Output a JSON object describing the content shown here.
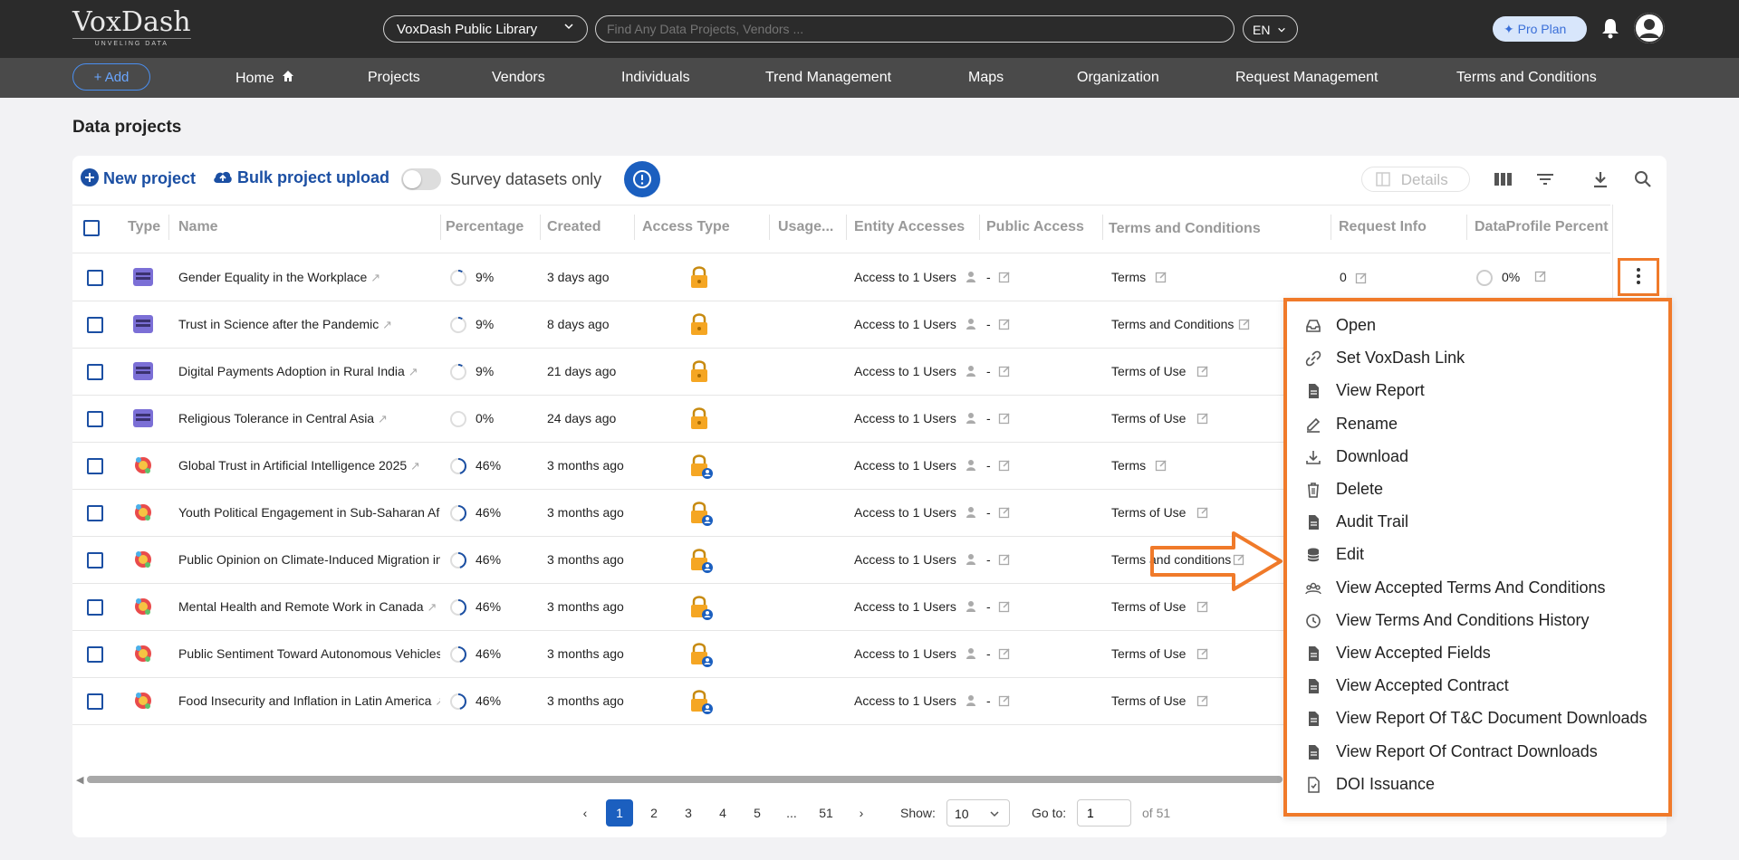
{
  "header": {
    "logo_main": "VoxDash",
    "logo_sub": "UNVELING DATA",
    "library_select": "VoxDash Public Library",
    "search_placeholder": "Find Any Data Projects, Vendors ...",
    "language": "EN",
    "plan_label": "✦ Pro Plan",
    "icons": [
      "chevron-down-icon",
      "bell-icon",
      "user-avatar-icon"
    ]
  },
  "nav": {
    "add_label": "+ Add",
    "items": [
      "Home",
      "Projects",
      "Vendors",
      "Individuals",
      "Trend Management",
      "Maps",
      "Organization",
      "Request Management",
      "Terms and Conditions"
    ]
  },
  "page": {
    "title": "Data projects",
    "new_project": "New project",
    "bulk_upload": "Bulk project upload",
    "survey_toggle": "Survey datasets only",
    "survey_toggle_on": false,
    "details": "Details"
  },
  "table": {
    "columns": [
      "Type",
      "Name",
      "Percentage",
      "Created",
      "Access Type",
      "Usage...",
      "Entity Accesses",
      "Public Access",
      "Terms and Conditions",
      "Request Info",
      "DataProfile Percent"
    ],
    "rows": [
      {
        "type": "dataset",
        "name": "Gender Equality in the Workplace",
        "pct": "9%",
        "pct_value": 0.09,
        "created": "3 days ago",
        "access": "lock",
        "entity": "Access to 1 Users",
        "public": "-",
        "terms": "Terms",
        "request": "0",
        "dp": "0%"
      },
      {
        "type": "dataset",
        "name": "Trust in Science after the Pandemic",
        "pct": "9%",
        "pct_value": 0.09,
        "created": "8 days ago",
        "access": "lock",
        "entity": "Access to 1 Users",
        "public": "-",
        "terms": "Terms and Conditions"
      },
      {
        "type": "dataset",
        "name": "Digital Payments Adoption in Rural India",
        "pct": "9%",
        "pct_value": 0.09,
        "created": "21 days ago",
        "access": "lock",
        "entity": "Access to 1 Users",
        "public": "-",
        "terms": "Terms of Use"
      },
      {
        "type": "dataset",
        "name": "Religious Tolerance in Central Asia",
        "pct": "0%",
        "pct_value": 0,
        "created": "24 days ago",
        "access": "lock",
        "entity": "Access to 1 Users",
        "public": "-",
        "terms": "Terms of Use"
      },
      {
        "type": "survey",
        "name": "Global Trust in Artificial Intelligence 2025",
        "pct": "46%",
        "pct_value": 0.46,
        "created": "3 months ago",
        "access": "lock-user",
        "entity": "Access to 1 Users",
        "public": "-",
        "terms": "Terms"
      },
      {
        "type": "survey",
        "name": "Youth Political Engagement in Sub-Saharan Afr",
        "pct": "46%",
        "pct_value": 0.46,
        "created": "3 months ago",
        "access": "lock-user",
        "entity": "Access to 1 Users",
        "public": "-",
        "terms": "Terms of Use"
      },
      {
        "type": "survey",
        "name": "Public Opinion on Climate-Induced Migration in",
        "pct": "46%",
        "pct_value": 0.46,
        "created": "3 months ago",
        "access": "lock-user",
        "entity": "Access to 1 Users",
        "public": "-",
        "terms": "Terms and conditions"
      },
      {
        "type": "survey",
        "name": "Mental Health and Remote Work in Canada",
        "pct": "46%",
        "pct_value": 0.46,
        "created": "3 months ago",
        "access": "lock-user",
        "entity": "Access to 1 Users",
        "public": "-",
        "terms": "Terms of Use"
      },
      {
        "type": "survey",
        "name": "Public Sentiment Toward Autonomous Vehicles",
        "pct": "46%",
        "pct_value": 0.46,
        "created": "3 months ago",
        "access": "lock-user",
        "entity": "Access to 1 Users",
        "public": "-",
        "terms": "Terms of Use"
      },
      {
        "type": "survey",
        "name": "Food Insecurity and Inflation in Latin America",
        "pct": "46%",
        "pct_value": 0.46,
        "created": "3 months ago",
        "access": "lock-user",
        "entity": "Access to 1 Users",
        "public": "-",
        "terms": "Terms of Use"
      }
    ]
  },
  "menu": {
    "items": [
      {
        "label": "Open",
        "icon": "inbox-icon"
      },
      {
        "label": "Set VoxDash Link",
        "icon": "link-icon"
      },
      {
        "label": "View Report",
        "icon": "document-icon"
      },
      {
        "label": "Rename",
        "icon": "edit-icon"
      },
      {
        "label": "Download",
        "icon": "download-icon"
      },
      {
        "label": "Delete",
        "icon": "trash-icon"
      },
      {
        "label": "Audit Trail",
        "icon": "document-icon"
      },
      {
        "label": "Edit",
        "icon": "database-icon"
      },
      {
        "label": "View Accepted Terms And Conditions",
        "icon": "users-icon"
      },
      {
        "label": "View Terms And Conditions History",
        "icon": "clock-icon"
      },
      {
        "label": "View Accepted Fields",
        "icon": "document-icon"
      },
      {
        "label": "View Accepted Contract",
        "icon": "document-icon"
      },
      {
        "label": "View Report Of T&C Document Downloads",
        "icon": "document-icon"
      },
      {
        "label": "View Report Of Contract Downloads",
        "icon": "document-icon"
      },
      {
        "label": "DOI Issuance",
        "icon": "document-check-icon"
      }
    ]
  },
  "pagination": {
    "pages": [
      "1",
      "2",
      "3",
      "4",
      "5",
      "...",
      "51"
    ],
    "current": "1",
    "show_label": "Show:",
    "show_value": "10",
    "goto_label": "Go to:",
    "goto_value": "1",
    "of_total": "of 51"
  },
  "colors": {
    "accent": "#1b5fbf",
    "highlight": "#f07a2a",
    "lock": "#f5a623"
  }
}
